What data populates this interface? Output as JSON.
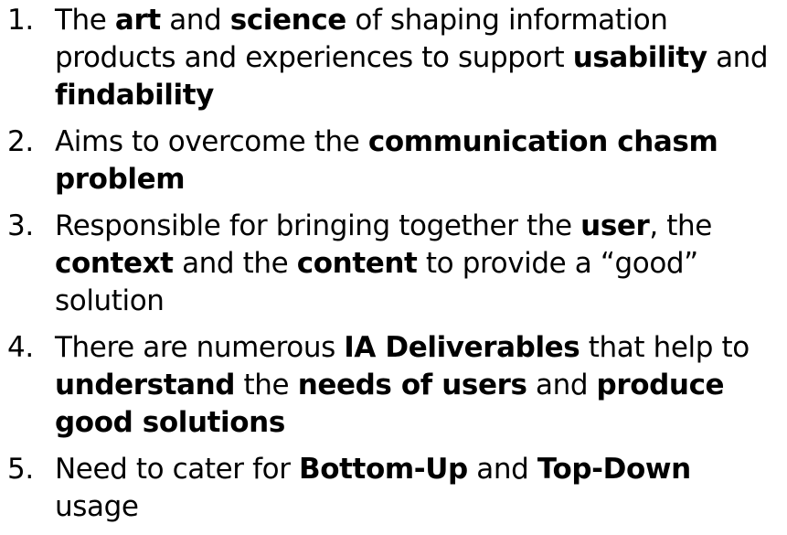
{
  "items": [
    {
      "number": "1.",
      "segments": [
        {
          "text": "The ",
          "bold": false
        },
        {
          "text": "art",
          "bold": true
        },
        {
          "text": " and ",
          "bold": false
        },
        {
          "text": "science",
          "bold": true
        },
        {
          "text": " of shaping information products and experiences to support ",
          "bold": false
        },
        {
          "text": "usability",
          "bold": true
        },
        {
          "text": " and ",
          "bold": false
        },
        {
          "text": "findability",
          "bold": true
        }
      ]
    },
    {
      "number": "2.",
      "segments": [
        {
          "text": "Aims to overcome the ",
          "bold": false
        },
        {
          "text": "communication chasm problem",
          "bold": true
        }
      ]
    },
    {
      "number": "3.",
      "segments": [
        {
          "text": "Responsible for bringing together the ",
          "bold": false
        },
        {
          "text": "user",
          "bold": true
        },
        {
          "text": ", the ",
          "bold": false
        },
        {
          "text": "context",
          "bold": true
        },
        {
          "text": " and the ",
          "bold": false
        },
        {
          "text": "content",
          "bold": true
        },
        {
          "text": " to provide a “good” solution",
          "bold": false
        }
      ]
    },
    {
      "number": "4.",
      "segments": [
        {
          "text": "There are numerous ",
          "bold": false
        },
        {
          "text": "IA Deliverables",
          "bold": true
        },
        {
          "text": " that help to ",
          "bold": false
        },
        {
          "text": "understand",
          "bold": true
        },
        {
          "text": " the ",
          "bold": false
        },
        {
          "text": "needs of users",
          "bold": true
        },
        {
          "text": " and ",
          "bold": false
        },
        {
          "text": "produce good solutions",
          "bold": true
        }
      ]
    },
    {
      "number": "5.",
      "segments": [
        {
          "text": "Need to cater for ",
          "bold": false
        },
        {
          "text": "Bottom-Up",
          "bold": true
        },
        {
          "text": " and ",
          "bold": false
        },
        {
          "text": "Top-Down",
          "bold": true
        },
        {
          "text": " usage",
          "bold": false
        }
      ]
    }
  ]
}
